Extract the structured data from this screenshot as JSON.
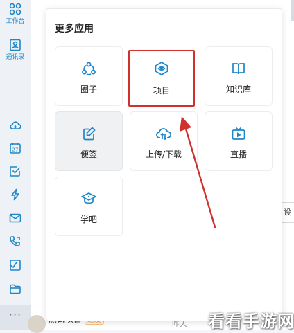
{
  "sidebar": {
    "items": [
      {
        "label": "工作台",
        "icon": "grid-icon"
      },
      {
        "label": "通讯录",
        "icon": "contacts-icon"
      }
    ],
    "icons": [
      "cloud-icon",
      "calendar-icon",
      "check-icon",
      "lightning-icon",
      "mail-icon",
      "phone-icon",
      "box-icon",
      "folder-icon"
    ],
    "calendar_day": "27",
    "more": "···"
  },
  "popup": {
    "title": "更多应用",
    "apps": [
      {
        "label": "圈子",
        "icon": "circle-group-icon"
      },
      {
        "label": "项目",
        "icon": "project-icon"
      },
      {
        "label": "知识库",
        "icon": "book-icon"
      },
      {
        "label": "便签",
        "icon": "note-edit-icon"
      },
      {
        "label": "上传/下载",
        "icon": "cloud-transfer-icon"
      },
      {
        "label": "直播",
        "icon": "live-tv-icon"
      },
      {
        "label": "学吧",
        "icon": "graduation-cap-icon"
      }
    ]
  },
  "background": {
    "row_title": "测试项目",
    "row_tag": "进度",
    "row_time": "昨天",
    "side_button": "设"
  },
  "watermark": "看看手游网",
  "colors": {
    "accent": "#1f87c8",
    "highlight": "#d0312d"
  }
}
